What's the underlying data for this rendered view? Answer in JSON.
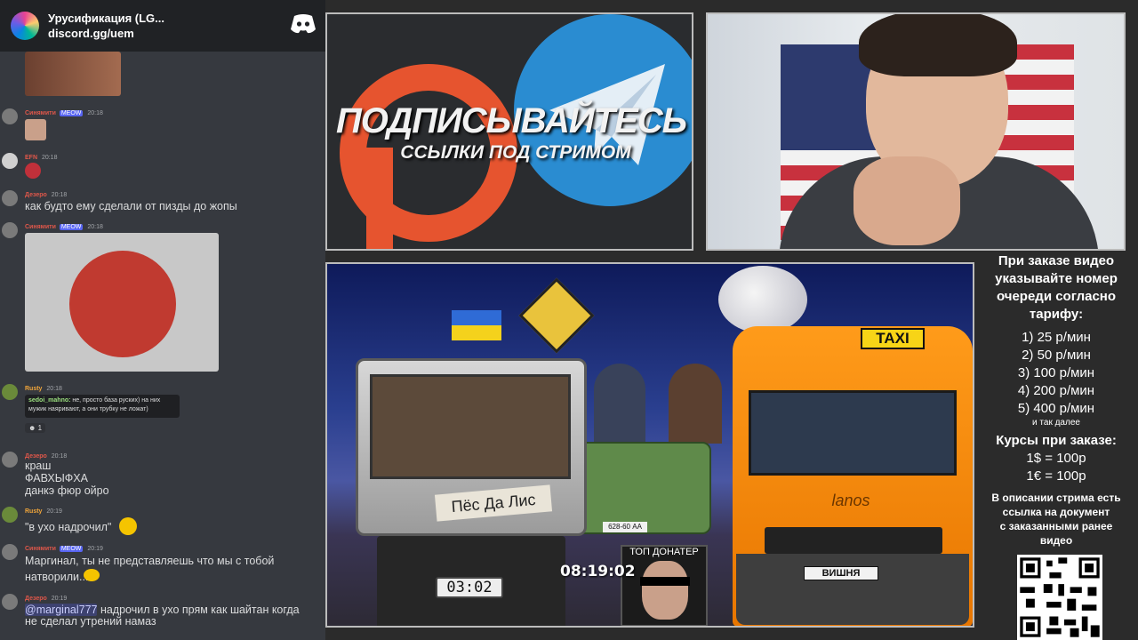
{
  "discord": {
    "server_title": "Урусификация (LG...",
    "server_link": "discord.gg/uem",
    "messages": [
      {
        "user": "Синямити",
        "badge": "MEOW",
        "time": "20:18"
      },
      {
        "user": "EFN",
        "time": "20:18"
      },
      {
        "user": "Дезеро",
        "time": "20:18",
        "text": "как будто ему сделали от пизды до жопы"
      },
      {
        "user": "Синямити",
        "badge": "MEOW",
        "time": "20:18"
      },
      {
        "user": "Rusty",
        "time": "20:18",
        "reply_user": "sedoi_mahno:",
        "reply_text": "не, просто база руских) на них мужик наяривают, а они трубку не ложат)",
        "reaction_count": "1"
      },
      {
        "user": "Дезеро",
        "time": "20:18",
        "lines": [
          "краш",
          "ФАВХЫФХА",
          "данкэ фюр ойро"
        ]
      },
      {
        "user": "Rusty",
        "time": "20:19",
        "text": "\"в ухо надрочил\""
      },
      {
        "user": "Синямити",
        "badge": "MEOW",
        "time": "20:19",
        "lines": [
          "Маргинал, ты не представляешь что мы с тобой",
          "натворили..."
        ]
      },
      {
        "user": "Дезеро",
        "time": "20:19",
        "mention": "@marginal777",
        "lines": [
          " надрочил в ухо прям как шайтан когда",
          "не сделал утрений намаз"
        ]
      }
    ]
  },
  "promo": {
    "title": "ПОДПИСЫВАЙТЕСЬ",
    "subtitle": "ССЫЛКИ ПОД СТРИМОМ"
  },
  "game": {
    "jeep_label": "Пёс Да Лис",
    "jeep_timer": "03:02",
    "niva_plate": "628-60 АА",
    "taxi_sign": "TAXI",
    "bus_brand": "lanos",
    "bus_plate": "ВИШНЯ",
    "clock": "08:19:02",
    "top_donor_label": "ТОП ДОНАТЕР"
  },
  "info": {
    "heading": [
      "При заказе видео",
      "указывайте номер",
      "очереди согласно",
      "тарифу:"
    ],
    "tariffs": [
      "1) 25 р/мин",
      "2) 50 р/мин",
      "3) 100 р/мин",
      "4) 200 р/мин",
      "5) 400 р/мин"
    ],
    "etc": "и так далее",
    "rates_heading": "Курсы при заказе:",
    "rates": [
      "1$ = 100р",
      "1€ = 100р"
    ],
    "description": [
      "В описании стрима есть",
      "ссылка на документ",
      "с заказанными ранее",
      "видео"
    ]
  }
}
